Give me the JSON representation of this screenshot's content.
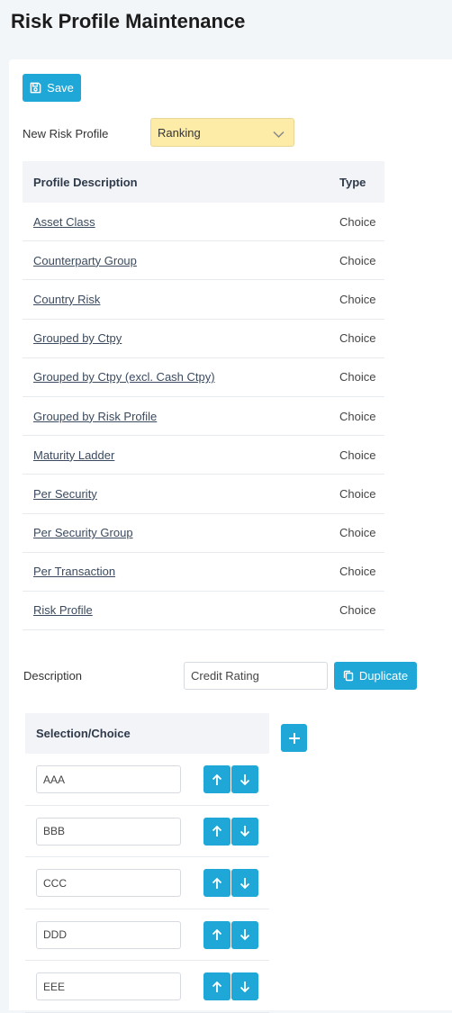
{
  "page": {
    "title": "Risk Profile Maintenance"
  },
  "toolbar": {
    "save_label": "Save",
    "save_icon": "floppy-disk-icon"
  },
  "new_profile": {
    "label": "New Risk Profile",
    "selected": "Ranking"
  },
  "profiles_table": {
    "headers": [
      "Profile Description",
      "Type"
    ],
    "rows": [
      {
        "description": "Asset Class",
        "type": "Choice"
      },
      {
        "description": "Counterparty Group",
        "type": "Choice"
      },
      {
        "description": "Country Risk",
        "type": "Choice"
      },
      {
        "description": "Grouped by Ctpy",
        "type": "Choice"
      },
      {
        "description": "Grouped by Ctpy (excl. Cash Ctpy)",
        "type": "Choice"
      },
      {
        "description": "Grouped by Risk Profile",
        "type": "Choice"
      },
      {
        "description": "Maturity Ladder",
        "type": "Choice"
      },
      {
        "description": "Per Security",
        "type": "Choice"
      },
      {
        "description": "Per Security Group",
        "type": "Choice"
      },
      {
        "description": "Per Transaction",
        "type": "Choice"
      },
      {
        "description": "Risk Profile",
        "type": "Choice"
      }
    ]
  },
  "description": {
    "label": "Description",
    "value": "Credit Rating",
    "duplicate_label": "Duplicate",
    "duplicate_icon": "copy-icon"
  },
  "selection": {
    "header": "Selection/Choice",
    "add_icon": "plus-icon",
    "items": [
      "AAA",
      "BBB",
      "CCC",
      "DDD",
      "EEE"
    ]
  },
  "colors": {
    "accent": "#1ea7d7",
    "select_bg": "#fdeba8",
    "header_bg": "#f2f4f7",
    "page_bg": "#f3f6f9"
  }
}
